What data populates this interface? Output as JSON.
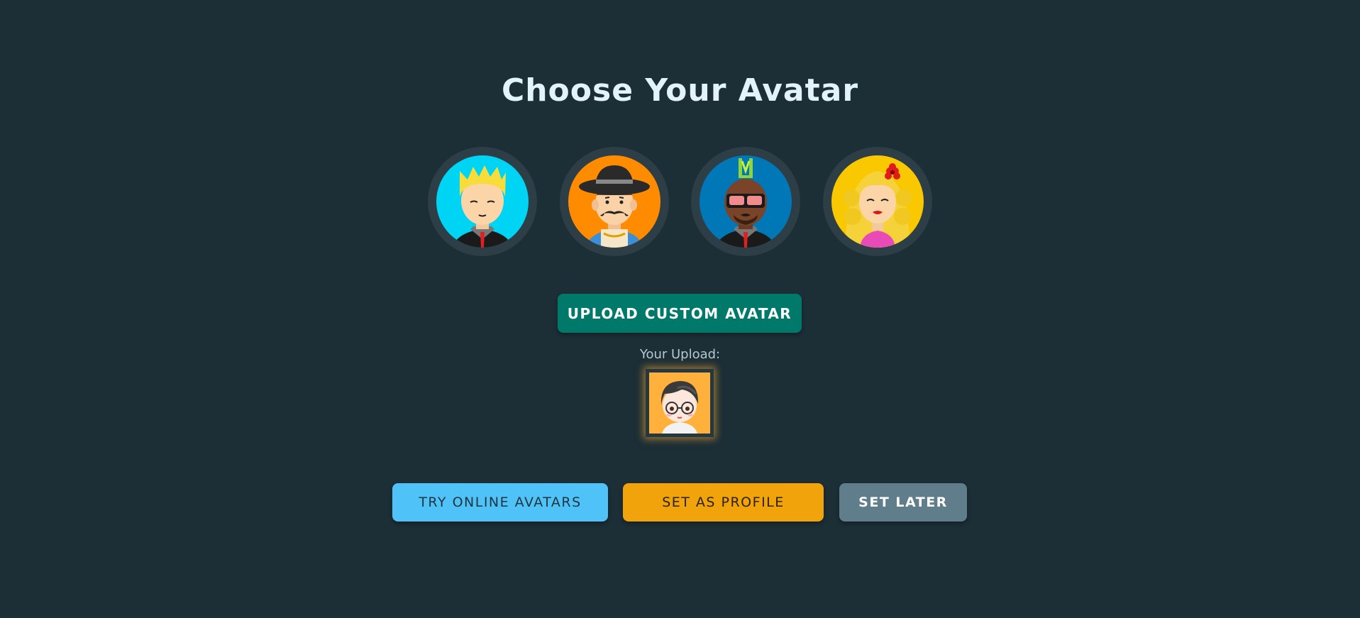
{
  "page": {
    "title": "Choose Your Avatar"
  },
  "avatars": [
    {
      "name": "blond-boy-avatar",
      "background": "#00d4f5"
    },
    {
      "name": "hat-mustache-man-avatar",
      "background": "#ff8c00"
    },
    {
      "name": "mohawk-sunglasses-man-avatar",
      "background": "#0077b6"
    },
    {
      "name": "curly-blonde-woman-avatar",
      "background": "#fac800"
    }
  ],
  "upload": {
    "button_label": "UPLOAD CUSTOM AVATAR",
    "preview_label": "Your Upload:",
    "preview_icon": "user-uploaded-avatar-glasses",
    "preview_background": "#ffb13c"
  },
  "actions": {
    "online_label": "TRY ONLINE AVATARS",
    "profile_label": "SET AS PROFILE",
    "later_label": "SET LATER"
  },
  "colors": {
    "background": "#1c2e36",
    "upload_button": "#00796b",
    "online_button": "#4fc3f7",
    "profile_button": "#f0a30a",
    "later_button": "#607d8b"
  }
}
